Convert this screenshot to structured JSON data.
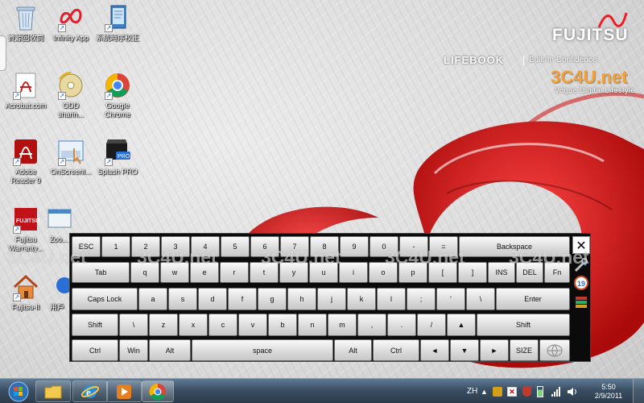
{
  "desktop": {
    "icons": [
      {
        "label": "資源回收筒",
        "icon": "recycle-bin-icon"
      },
      {
        "label": "Infinity App",
        "icon": "infinity-icon"
      },
      {
        "label": "系統時序校正",
        "icon": "document-tool-icon"
      },
      {
        "label": "Acrobat.com",
        "icon": "acrobat-icon"
      },
      {
        "label": "ODD",
        "label2": "sharin...",
        "icon": "disc-share-icon"
      },
      {
        "label": "Google",
        "label2": "Chrome",
        "icon": "chrome-icon"
      },
      {
        "label": "Adobe",
        "label2": "Reader 9",
        "icon": "adobe-reader-icon"
      },
      {
        "label": "OnScreenI...",
        "icon": "onscreen-keyboard-icon"
      },
      {
        "label": "Splash PRO",
        "icon": "splash-pro-icon"
      },
      {
        "label": "Fujitsu",
        "label2": "Warranty...",
        "icon": "fujitsu-icon"
      },
      {
        "label": "Zoo...",
        "icon": "zoom-icon"
      },
      {
        "label": "Fujitsu-II",
        "icon": "house-icon"
      },
      {
        "label": "用戶",
        "icon": "user-icon"
      }
    ]
  },
  "branding": {
    "brand": "FUJITSU",
    "product": "LIFEBOOK",
    "tagline": "Built-In Confidence",
    "site": "3C4U.net",
    "slogan": "Vogue.Digital.Lifestyle",
    "watermark": "3C4U.net"
  },
  "keyboard": {
    "rows": [
      [
        "ESC",
        "1",
        "2",
        "3",
        "4",
        "5",
        "6",
        "7",
        "8",
        "9",
        "0",
        "-",
        "=",
        "Backspace"
      ],
      [
        "Tab",
        "q",
        "w",
        "e",
        "r",
        "t",
        "y",
        "u",
        "i",
        "o",
        "p",
        "[",
        "]",
        "INS",
        "DEL",
        "Fn"
      ],
      [
        "Caps Lock",
        "a",
        "s",
        "d",
        "f",
        "g",
        "h",
        "j",
        "k",
        "l",
        ";",
        "'",
        "\\",
        "Enter"
      ],
      [
        "Shift",
        "\\",
        "z",
        "x",
        "c",
        "v",
        "b",
        "n",
        "m",
        ",",
        ".",
        "/",
        "▲",
        "Shift"
      ],
      [
        "Ctrl",
        "Win",
        "Alt",
        "space",
        "Alt",
        "Ctrl",
        "◄",
        "▼",
        "►",
        "SIZE"
      ]
    ],
    "close": "✕"
  },
  "taskbar": {
    "pinned": [
      "explorer-icon",
      "ie-icon",
      "media-player-icon",
      "chrome-icon"
    ],
    "lang": "ZH",
    "time": "5:50",
    "date": "2/9/2011"
  }
}
